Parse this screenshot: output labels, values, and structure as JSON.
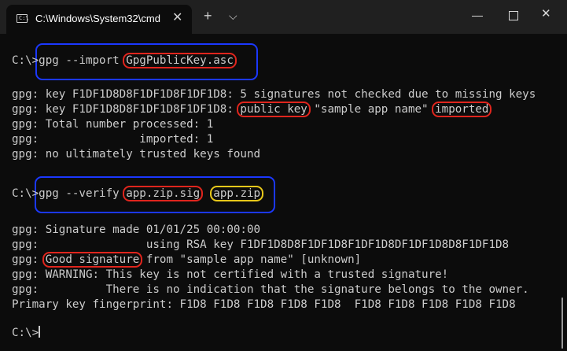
{
  "window": {
    "tab_title": "C:\\Windows\\System32\\cmd",
    "tab_icon_glyph": "C:\\",
    "close_glyph": "✕",
    "newtab_glyph": "+",
    "dropdown_glyph": "⌵",
    "minimize_glyph": "",
    "close_window_glyph": "✕"
  },
  "terminal": {
    "prompt": "C:\\>",
    "cmd1": {
      "cmd": "gpg --import",
      "arg": "GpgPublicKey.asc"
    },
    "import_lines": {
      "l1": "gpg: key F1DF1D8D8F1DF1D8F1DF1D8: 5 signatures not checked due to missing keys",
      "l2_pre": "gpg: key F1DF1D8D8F1DF1D8F1DF1D8: ",
      "l2_hl1": "public key",
      "l2_mid": " \"sample app name\" ",
      "l2_hl2": "imported",
      "l3": "gpg: Total number processed: 1",
      "l4": "gpg:               imported: 1",
      "l5": "gpg: no ultimately trusted keys found"
    },
    "cmd2": {
      "cmd": "gpg --verify ",
      "arg1": "app.zip.sig",
      "arg2": "app.zip"
    },
    "verify_lines": {
      "l1": "gpg: Signature made 01/01/25 00:00:00",
      "l2": "gpg:                using RSA key F1DF1D8D8F1DF1D8F1DF1D8DF1DF1D8D8F1DF1D8",
      "l3_pre": "gpg: ",
      "l3_hl": "Good signature",
      "l3_post": " from \"sample app name\" [unknown]",
      "l4": "gpg: WARNING: This key is not certified with a trusted signature!",
      "l5": "gpg:          There is no indication that the signature belongs to the owner.",
      "l6": "Primary key fingerprint: F1D8 F1D8 F1D8 F1D8 F1D8  F1D8 F1D8 F1D8 F1D8 F1D8"
    },
    "final_prompt": "C:\\>"
  }
}
